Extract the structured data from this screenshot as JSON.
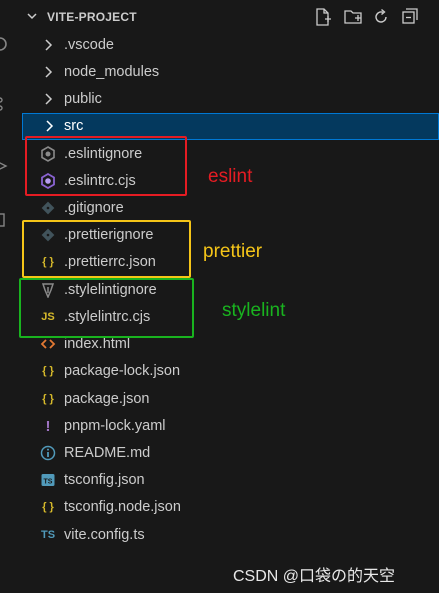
{
  "explorer": {
    "title": "VITE-PROJECT",
    "header_actions": [
      "new-file-icon",
      "new-folder-icon",
      "refresh-icon",
      "collapse-all-icon"
    ]
  },
  "tree": [
    {
      "label": ".vscode",
      "icon": "chevron-right-icon",
      "type": "folder"
    },
    {
      "label": "node_modules",
      "icon": "chevron-right-icon",
      "type": "folder"
    },
    {
      "label": "public",
      "icon": "chevron-right-icon",
      "type": "folder"
    },
    {
      "label": "src",
      "icon": "chevron-right-icon",
      "type": "folder",
      "selected": true
    },
    {
      "label": ".eslintignore",
      "icon": "eslint-gray-icon",
      "type": "file"
    },
    {
      "label": ".eslintrc.cjs",
      "icon": "eslint-purple-icon",
      "type": "file"
    },
    {
      "label": ".gitignore",
      "icon": "git-icon",
      "type": "file"
    },
    {
      "label": ".prettierignore",
      "icon": "prettier-gray-icon",
      "type": "file"
    },
    {
      "label": ".prettierrc.json",
      "icon": "json-braces-icon",
      "type": "file"
    },
    {
      "label": ".stylelintignore",
      "icon": "stylelint-icon",
      "type": "file"
    },
    {
      "label": ".stylelintrc.cjs",
      "icon": "js-icon",
      "type": "file"
    },
    {
      "label": "index.html",
      "icon": "html-icon",
      "type": "file"
    },
    {
      "label": "package-lock.json",
      "icon": "json-braces-icon",
      "type": "file"
    },
    {
      "label": "package.json",
      "icon": "json-braces-icon",
      "type": "file"
    },
    {
      "label": "pnpm-lock.yaml",
      "icon": "yaml-exclamation-icon",
      "type": "file"
    },
    {
      "label": "README.md",
      "icon": "info-icon",
      "type": "file"
    },
    {
      "label": "tsconfig.json",
      "icon": "tsconfig-icon",
      "type": "file"
    },
    {
      "label": "tsconfig.node.json",
      "icon": "json-braces-icon",
      "type": "file"
    },
    {
      "label": "vite.config.ts",
      "icon": "ts-icon",
      "type": "file"
    }
  ],
  "annotations": {
    "eslint": {
      "text": "eslint",
      "color": "#e51c23"
    },
    "prettier": {
      "text": "prettier",
      "color": "#f5c518"
    },
    "stylelint": {
      "text": "stylelint",
      "color": "#19b31f"
    }
  },
  "colors": {
    "selection_bg": "#04395e",
    "selection_border": "#0078d4",
    "json_brace": "#d7ba2b",
    "eslint_purple": "#8a63d2",
    "html_orange": "#e37933",
    "ts_blue": "#519aba",
    "yaml_purple": "#a074c4"
  },
  "watermark": "CSDN @口袋の的天空"
}
